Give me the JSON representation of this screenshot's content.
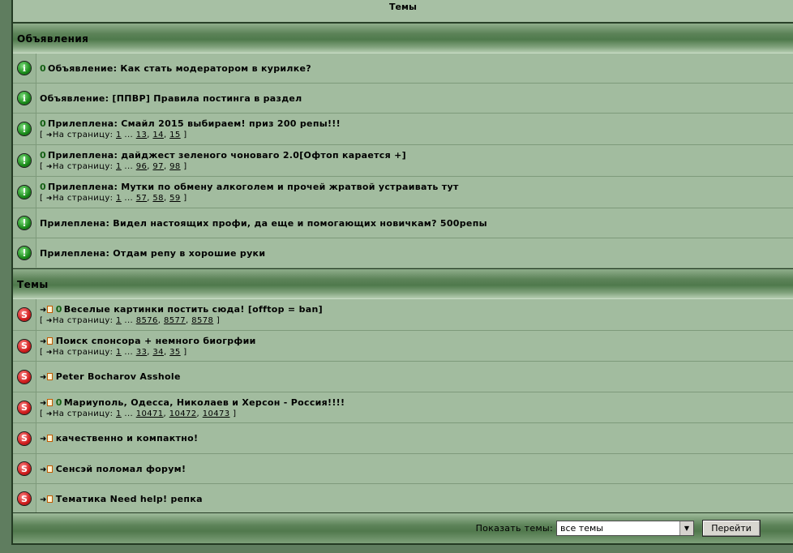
{
  "header": {
    "title": "Темы"
  },
  "announcements": {
    "label": "Объявления",
    "rows": [
      {
        "icon": "info",
        "clip": true,
        "title": "Объявление: Как стать модератором в курилке?",
        "pages": null
      },
      {
        "icon": "info",
        "clip": false,
        "title": "Объявление: [ППВР] Правила постинга в раздел",
        "pages": null
      },
      {
        "icon": "sticky",
        "clip": true,
        "title": "Прилеплена: Смайл 2015 выбираем! приз 200 репы!!!",
        "pages": [
          "1",
          "13",
          "14",
          "15"
        ]
      },
      {
        "icon": "sticky",
        "clip": true,
        "title": "Прилеплена: дайджест зеленого чоноваго 2.0[Офтоп карается +]",
        "pages": [
          "1",
          "96",
          "97",
          "98"
        ]
      },
      {
        "icon": "sticky",
        "clip": true,
        "title": "Прилеплена: Мутки по обмену алкоголем и прочей жратвой устраивать тут",
        "pages": [
          "1",
          "57",
          "58",
          "59"
        ]
      },
      {
        "icon": "sticky",
        "clip": false,
        "title": "Прилеплена: Видел настоящих профи, да еще и помогающих новичкам? 500репы",
        "pages": null
      },
      {
        "icon": "sticky",
        "clip": false,
        "title": "Прилеплена: Отдам репу в хорошие руки",
        "pages": null
      }
    ]
  },
  "topics": {
    "label": "Темы",
    "rows": [
      {
        "icon": "hot",
        "clip": true,
        "title": "Веселые картинки постить сюда! [offtop = ban]",
        "pages": [
          "1",
          "8576",
          "8577",
          "8578"
        ]
      },
      {
        "icon": "hot",
        "clip": false,
        "title": "Поиск спонсора + немного биогрфии",
        "pages": [
          "1",
          "33",
          "34",
          "35"
        ]
      },
      {
        "icon": "hot",
        "clip": false,
        "title": "Peter Bocharov Asshole",
        "pages": null
      },
      {
        "icon": "hot",
        "clip": true,
        "title": "Мариуполь, Одесса, Николаев и Херсон - Россия!!!!",
        "pages": [
          "1",
          "10471",
          "10472",
          "10473"
        ]
      },
      {
        "icon": "hot",
        "clip": false,
        "title": "качественно и компактно!",
        "pages": null
      },
      {
        "icon": "hot",
        "clip": false,
        "title": "Сенсэй поломал форум!",
        "pages": null
      },
      {
        "icon": "hot",
        "clip": false,
        "title": "Тематика Need help! репка",
        "pages": null
      }
    ]
  },
  "pager": {
    "open": "[",
    "label": "На страницу:",
    "ellipsis": "...",
    "close": "]"
  },
  "icon_glyphs": {
    "info": "i",
    "sticky": "!",
    "hot": "S"
  },
  "footer": {
    "show_label": "Показать темы:",
    "select_value": "все темы",
    "go_label": "Перейти"
  }
}
